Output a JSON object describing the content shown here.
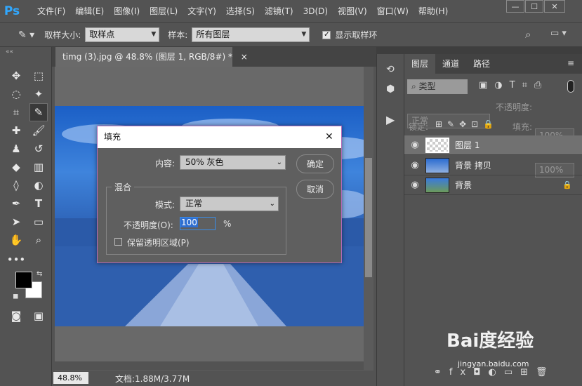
{
  "app": {
    "logo": "Ps"
  },
  "menu": [
    "文件(F)",
    "编辑(E)",
    "图像(I)",
    "图层(L)",
    "文字(Y)",
    "选择(S)",
    "滤镜(T)",
    "3D(D)",
    "视图(V)",
    "窗口(W)",
    "帮助(H)"
  ],
  "options": {
    "sample_size_label": "取样大小:",
    "sample_size_value": "取样点",
    "sample_label": "样本:",
    "sample_value": "所有图层",
    "show_ring_label": "显示取样环",
    "show_ring_checked": true
  },
  "document": {
    "tab_title": "timg (3).jpg @ 48.8% (图层 1, RGB/8#) *",
    "tab_close": "×"
  },
  "status": {
    "zoom": "48.8%",
    "doc_info": "文档:1.88M/3.77M"
  },
  "panel_tabs": [
    "图层",
    "通道",
    "路径"
  ],
  "layers": {
    "filter_label": "类型",
    "blend_mode": "正常",
    "opacity_label": "不透明度:",
    "opacity_value": "100%",
    "lock_label": "锁定:",
    "fill_label": "填充:",
    "fill_value": "100%",
    "items": [
      {
        "name": "图层 1",
        "selected": true,
        "visible": true
      },
      {
        "name": "背景 拷贝",
        "selected": false,
        "visible": true
      },
      {
        "name": "背景",
        "selected": false,
        "visible": true,
        "locked": true
      }
    ],
    "footer_fx": "fx"
  },
  "dialog": {
    "title": "填充",
    "close": "✕",
    "content_label": "内容:",
    "content_value": "50% 灰色",
    "blend_group": "混合",
    "mode_label": "模式:",
    "mode_value": "正常",
    "opacity_label": "不透明度(O):",
    "opacity_value": "100",
    "opacity_unit": "%",
    "preserve_label": "保留透明区域(P)",
    "preserve_checked": false,
    "ok": "确定",
    "cancel": "取消"
  },
  "colors": {
    "accent": "#31a8ff",
    "dialog_border": "#b46ab8",
    "foreground": "#000000",
    "background": "#ffffff"
  },
  "watermark": {
    "brand": "Bai度经验",
    "url": "jingyan.baidu.com"
  }
}
